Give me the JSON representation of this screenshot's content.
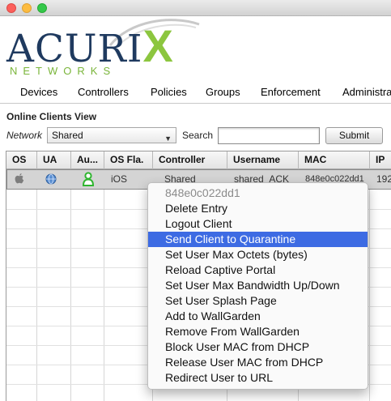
{
  "window": {
    "controls": [
      "close",
      "minimize",
      "maximize"
    ]
  },
  "logo": {
    "word_prefix": "ACURI",
    "word_x": "X",
    "subtitle": "NETWORKS",
    "primary_color": "#1f3a5f",
    "accent_color": "#8cc63f"
  },
  "nav": {
    "items": [
      {
        "label": "Devices"
      },
      {
        "label": "Controllers"
      },
      {
        "label": "Policies"
      },
      {
        "label": "Groups"
      },
      {
        "label": "Enforcement"
      },
      {
        "label": "Administra"
      }
    ]
  },
  "view": {
    "title": "Online Clients View"
  },
  "filter": {
    "network_label": "Network",
    "network_value": "Shared",
    "search_label": "Search",
    "search_value": "",
    "submit_label": "Submit"
  },
  "table": {
    "columns": [
      "OS",
      "UA",
      "Au...",
      "OS Fla.",
      "Controller",
      "Username",
      "MAC",
      "IP"
    ],
    "rows": [
      {
        "os_icon": "apple-icon",
        "ua_icon": "globe-icon",
        "auth_icon": "user-authenticated-icon",
        "os_flavor": "iOS",
        "controller": "Shared",
        "username": "shared_ACK",
        "mac": "848e0c022dd1",
        "ip": "192"
      }
    ]
  },
  "context_menu": {
    "header": "848e0c022dd1",
    "active_index": 2,
    "items": [
      "Delete Entry",
      "Logout Client",
      "Send Client to Quarantine",
      "Set User Max Octets (bytes)",
      "Reload Captive Portal",
      "Set User Max Bandwidth Up/Down",
      "Set User Splash Page",
      "Add to WallGarden",
      "Remove From WallGarden",
      "Block User MAC from DHCP",
      "Release User MAC from DHCP",
      "Redirect User to URL"
    ],
    "highlight_color": "#3d6be3"
  }
}
